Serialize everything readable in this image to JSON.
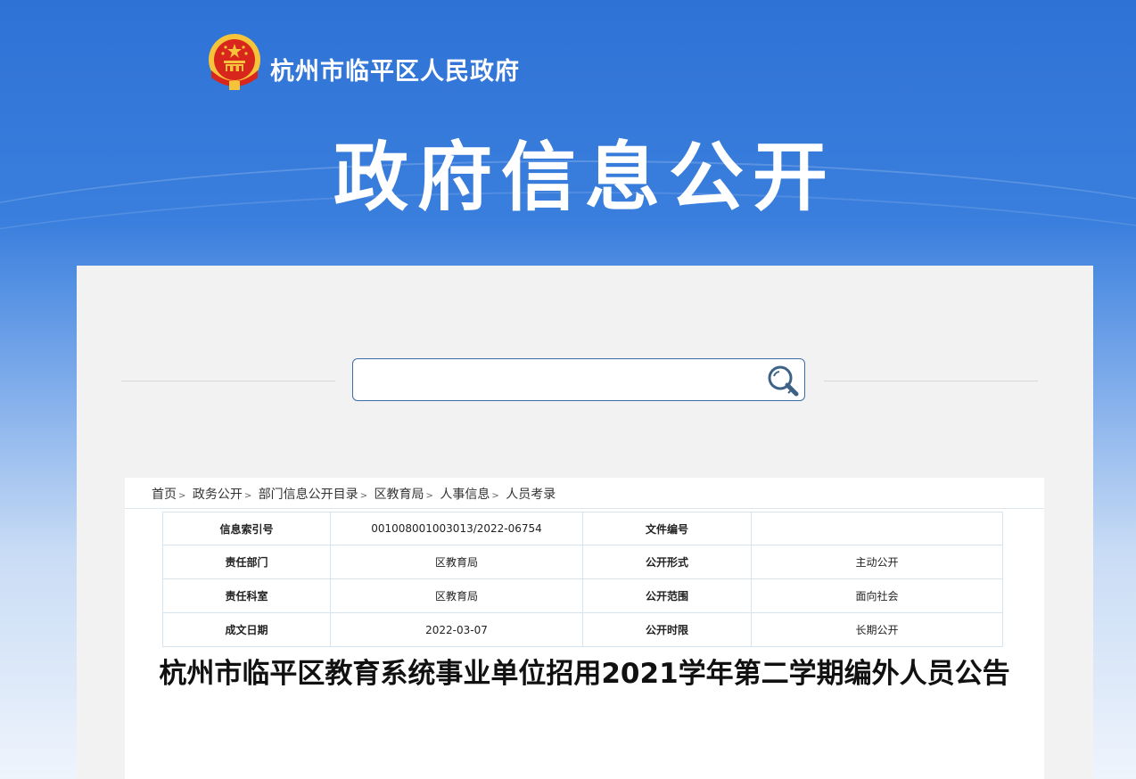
{
  "header": {
    "site_name": "杭州市临平区人民政府",
    "banner_title": "政府信息公开",
    "emblem_icon": "national-emblem-icon"
  },
  "search": {
    "value": "",
    "placeholder": "",
    "icon": "magnifier-icon"
  },
  "breadcrumb": [
    "首页",
    "政务公开",
    "部门信息公开目录",
    "区教育局",
    "人事信息",
    "人员考录"
  ],
  "meta_table": {
    "rows": [
      [
        {
          "label": "信息索引号",
          "value": "001008001003013/2022-06754"
        },
        {
          "label": "文件编号",
          "value": ""
        }
      ],
      [
        {
          "label": "责任部门",
          "value": "区教育局"
        },
        {
          "label": "公开形式",
          "value": "主动公开"
        }
      ],
      [
        {
          "label": "责任科室",
          "value": "区教育局"
        },
        {
          "label": "公开范围",
          "value": "面向社会"
        }
      ],
      [
        {
          "label": "成文日期",
          "value": "2022-03-07"
        },
        {
          "label": "公开时限",
          "value": "长期公开"
        }
      ]
    ]
  },
  "article": {
    "title": "杭州市临平区教育系统事业单位招用2021学年第二学期编外人员公告"
  },
  "colors": {
    "banner_blue": "#2f72d6",
    "search_border": "#3a6ea5",
    "emblem_red": "#d8261c",
    "emblem_gold": "#f5c43a"
  }
}
